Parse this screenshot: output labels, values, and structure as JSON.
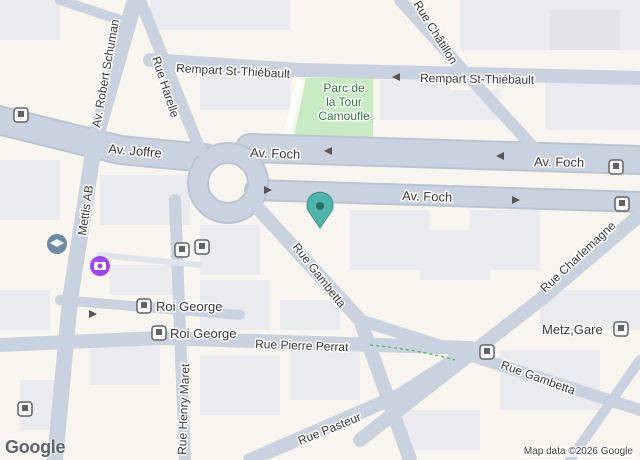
{
  "map": {
    "streets": {
      "rempart_1": "Rempart St-Thiébault",
      "rempart_2": "Rempart St-Thiébault",
      "foch_1": "Av. Foch",
      "foch_2": "Av. Foch",
      "foch_3": "Av. Foch",
      "joffre": "Av. Joffre",
      "harelle": "Rue Harelle",
      "schuman": "Av. Robert Schuman",
      "chatillon": "Rue Châtillon",
      "gambetta_1": "Rue Gambetta",
      "gambetta_2": "Rue Gambetta",
      "charlemagne": "Rue Charlemagne",
      "pierre_perrat": "Rue Pierre Perrat",
      "henry_maret": "Rue Henry Maret",
      "pasteur": "Rue Pasteur",
      "mettis": "Mettis AB"
    },
    "park": {
      "line1": "Parc de",
      "line2": "la Tour",
      "line3": "Camoufle"
    },
    "transit": {
      "roi_george_1": "Roi George",
      "roi_george_2": "Roi George",
      "metz_gare": "Metz,Gare"
    },
    "attribution": "Map data ©2026 Google",
    "logo": "Google"
  },
  "colors": {
    "background": "#f7f5ee",
    "road": "#c8d3df",
    "road_edge": "#b9c5d2",
    "building": "#e9ebee",
    "park": "#c9ebc4",
    "pin": "#4db6ac",
    "transit_icon": "#5f6368",
    "photo_icon": "#a142f4"
  },
  "icons": [
    "map-pin-icon",
    "bus-stop-icon",
    "tram-stop-icon",
    "school-icon",
    "camera-icon",
    "train-station-icon"
  ]
}
